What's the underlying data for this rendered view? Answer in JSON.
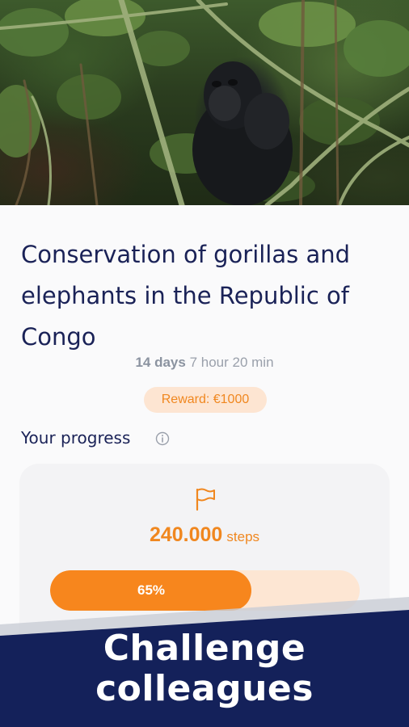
{
  "hero": {
    "image_subject": "gorilla-in-forest-photo"
  },
  "challenge": {
    "title": "Conservation of gorillas and elephants in the Republic of Congo",
    "duration_days": "14 days",
    "duration_rest": "7 hour 20 min",
    "reward": "Reward: €1000"
  },
  "progress": {
    "heading": "Your progress",
    "info_icon": "info-icon",
    "flag_icon": "flag-icon",
    "steps_value": "240.000",
    "steps_unit": "steps",
    "percent_label": "65%",
    "percent": 65
  },
  "banner": {
    "line1": "Challenge",
    "line2": "colleagues"
  },
  "colors": {
    "accent": "#f7861d",
    "navy": "#14215a",
    "title_text": "#1a2257",
    "reward_bg": "#fde5d2"
  }
}
